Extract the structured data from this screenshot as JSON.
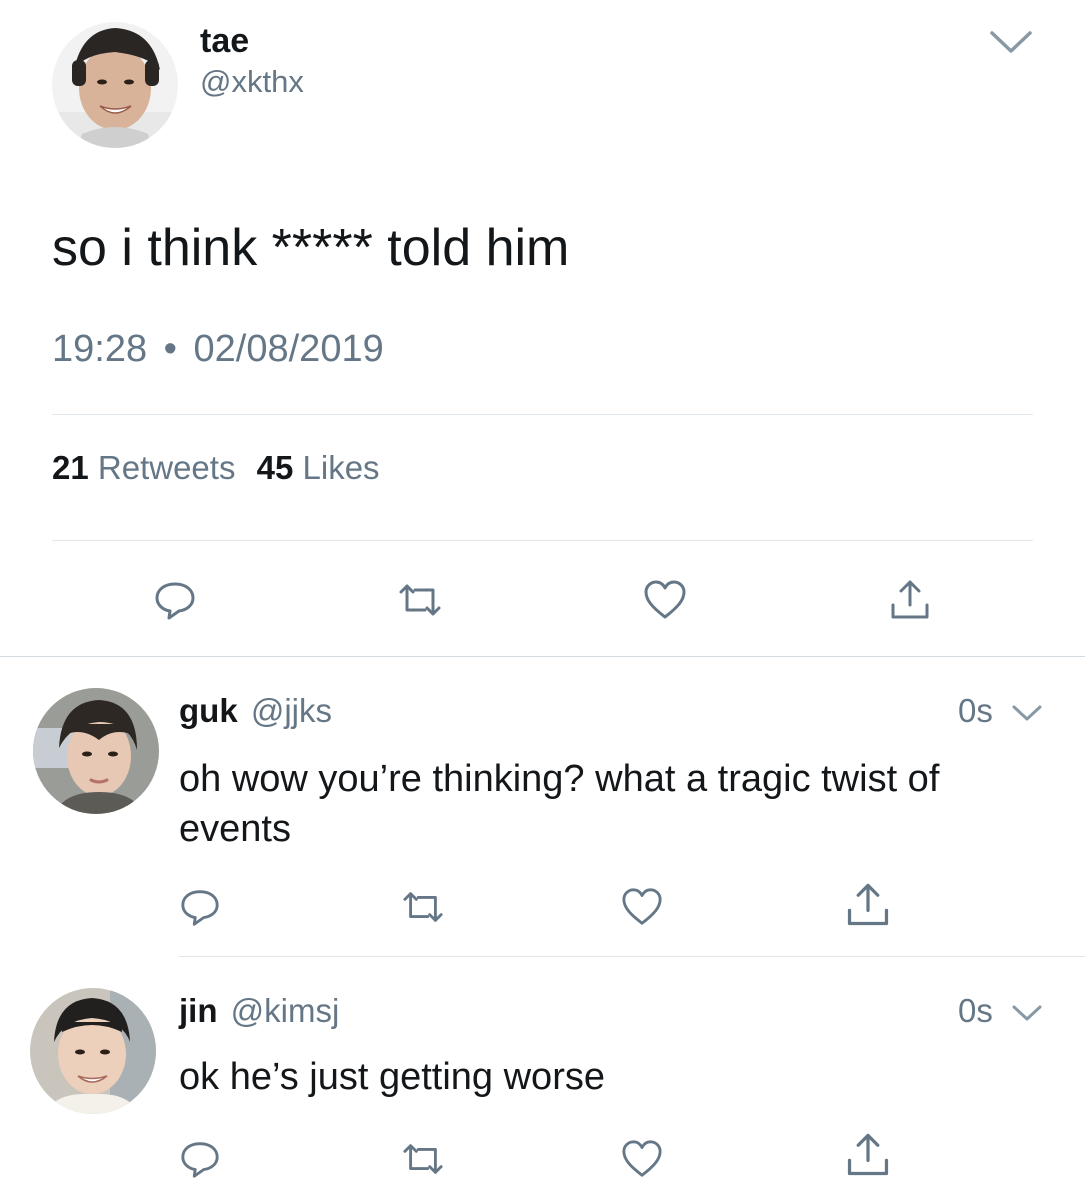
{
  "main_tweet": {
    "display_name": "tae",
    "handle": "@xkthx",
    "text": "so i think ***** told him",
    "time": "19:28",
    "separator": "•",
    "date": "02/08/2019",
    "retweets_count": "21",
    "retweets_label": "Retweets",
    "likes_count": "45",
    "likes_label": "Likes",
    "menu_icon": "chevron-down-icon",
    "actions": [
      "reply-icon",
      "retweet-icon",
      "like-icon",
      "share-icon"
    ]
  },
  "replies": [
    {
      "display_name": "guk",
      "handle": "@jjks",
      "time": "0s",
      "text": "oh wow you’re thinking? what a tragic twist of events",
      "actions": [
        "reply-icon",
        "retweet-icon",
        "like-icon",
        "share-icon"
      ]
    },
    {
      "display_name": "jin",
      "handle": "@kimsj",
      "time": "0s",
      "text": "ok he’s just getting worse",
      "actions": [
        "reply-icon",
        "retweet-icon",
        "like-icon",
        "share-icon"
      ]
    }
  ],
  "colors": {
    "text": "#14171a",
    "secondary": "#657786",
    "divider": "#e1e8ed",
    "icon": "#657786"
  }
}
